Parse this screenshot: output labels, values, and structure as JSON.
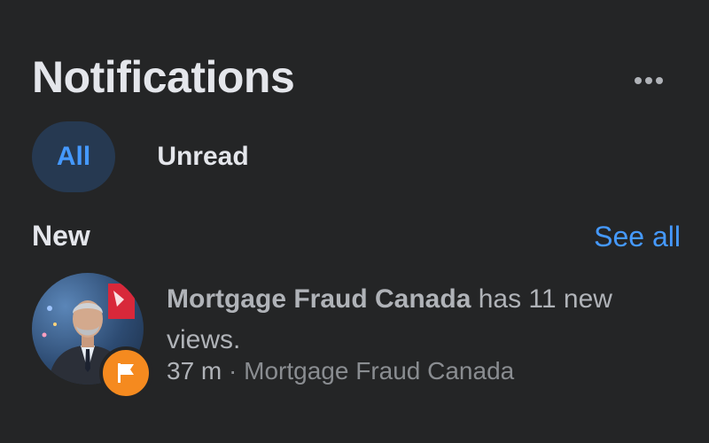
{
  "header": {
    "title": "Notifications",
    "more_icon": "more-horizontal-icon"
  },
  "tabs": [
    {
      "label": "All",
      "selected": true
    },
    {
      "label": "Unread",
      "selected": false
    }
  ],
  "section": {
    "title": "New",
    "see_all_label": "See all"
  },
  "notifications": [
    {
      "page_name": "Mortgage Fraud Canada",
      "message": " has 11 new views.",
      "time": "37 m",
      "separator": " · ",
      "source": "Mortgage Fraud Canada",
      "avatar_icon": "page-avatar",
      "badge_icon": "flag-icon",
      "badge_color": "#f58a1f"
    }
  ],
  "colors": {
    "background": "#242526",
    "accent": "#4599ff",
    "selected_tab_bg": "#263951",
    "text_primary": "#e4e6eb",
    "text_secondary": "#b0b3b8"
  }
}
